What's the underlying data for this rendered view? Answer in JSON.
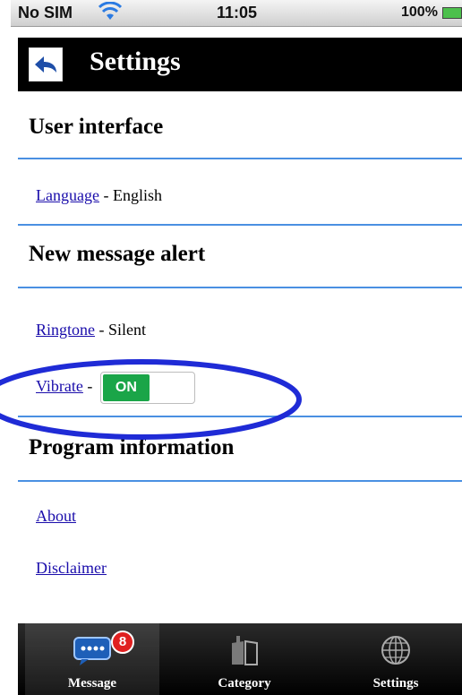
{
  "status_bar": {
    "carrier": "No SIM",
    "time": "11:05",
    "battery": "100%"
  },
  "header": {
    "title": "Settings",
    "back_icon": "back-arrow-icon"
  },
  "sections": {
    "user_interface": {
      "title": "User interface",
      "language_label": "Language",
      "language_value": "- English"
    },
    "new_message_alert": {
      "title": "New message alert",
      "ringtone_label": "Ringtone",
      "ringtone_value": "- Silent",
      "vibrate_label": "Vibrate",
      "vibrate_sep": "-",
      "vibrate_toggle": "ON"
    },
    "program_information": {
      "title": "Program information",
      "about_label": "About",
      "disclaimer_label": "Disclaimer"
    }
  },
  "tab_bar": {
    "tabs": [
      {
        "label": "Message",
        "icon": "message-bubble-icon",
        "badge": "8",
        "active": true
      },
      {
        "label": "Category",
        "icon": "book-icon"
      },
      {
        "label": "Settings",
        "icon": "globe-icon"
      }
    ]
  },
  "colors": {
    "divider": "#4a90e2",
    "toggle_on": "#1aa548",
    "link": "#1a0dab",
    "annotation": "#1f2bd6"
  }
}
